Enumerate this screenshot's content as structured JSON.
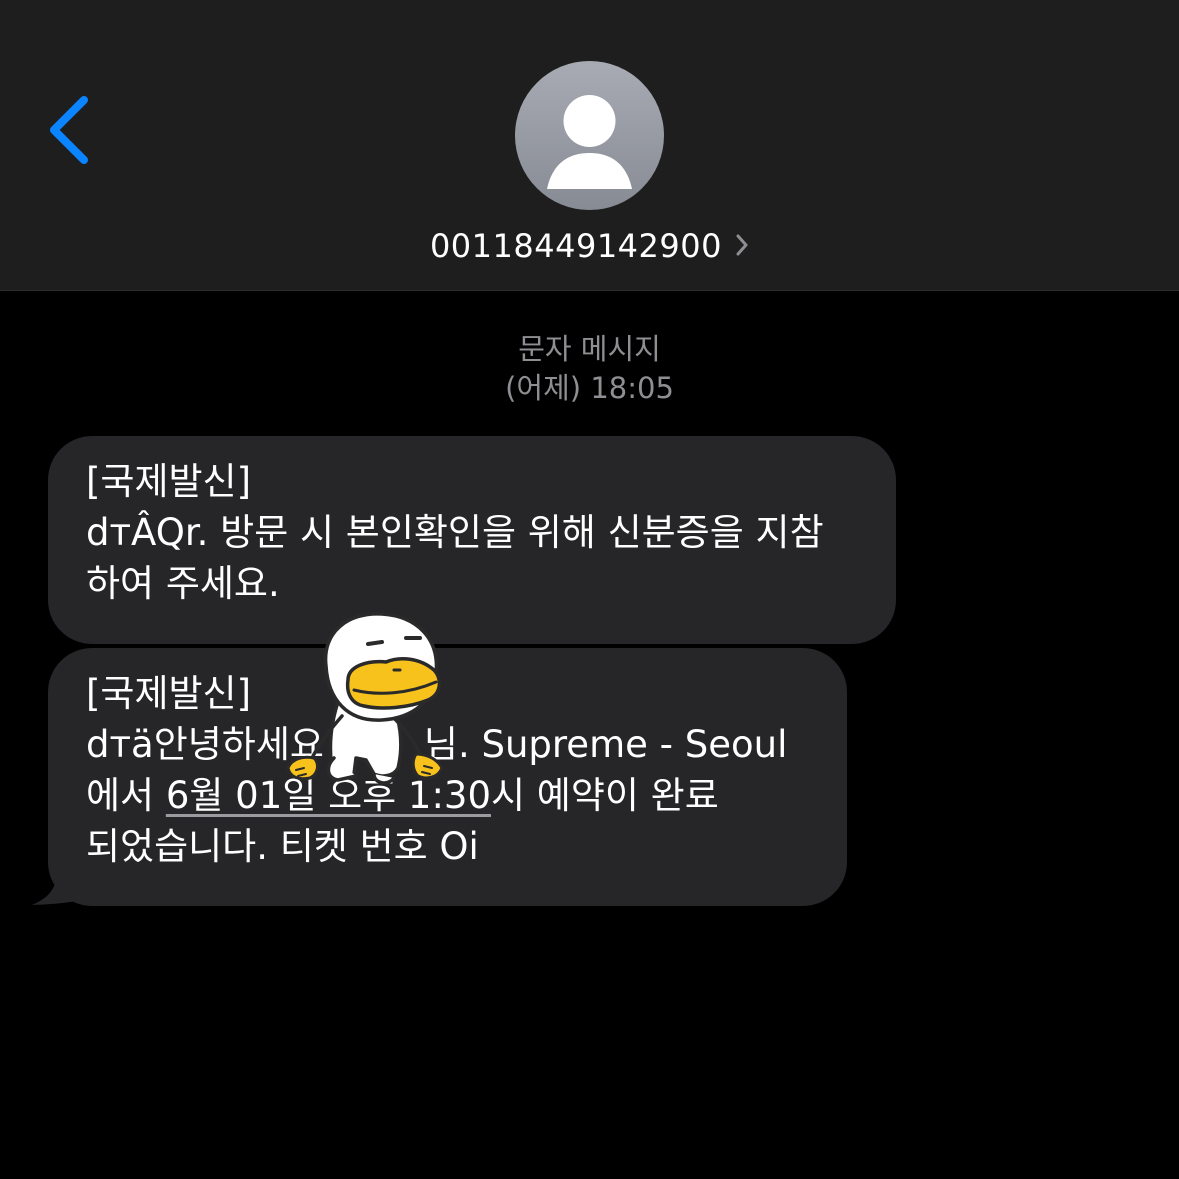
{
  "header": {
    "back_icon": "chevron-left-icon",
    "avatar_icon": "person-silhouette-icon",
    "contact_number": "00118449142900",
    "contact_chevron_icon": "chevron-right-icon",
    "accent_color": "#0a84ff"
  },
  "thread": {
    "kind_label": "문자 메시지",
    "timestamp": "(어제) 18:05"
  },
  "messages": [
    {
      "lines": [
        "[국제발신]",
        "dтÂQr. 방문 시 본인확인을 위해 신분증을 지참",
        "하여 주세요."
      ]
    },
    {
      "line1": "[국제발신]",
      "line2_pre": "dтä안녕하세요",
      "line2_post": "님. Supreme - Seoul",
      "line3_pre": "에서 ",
      "line3_link": "6월 01일 오후 1:30",
      "line3_post": "시 예약이 완료",
      "line4": "되었습니다. 티켓 번호 Oi"
    }
  ],
  "sticker": {
    "icon": "duck-character-sticker-icon"
  }
}
